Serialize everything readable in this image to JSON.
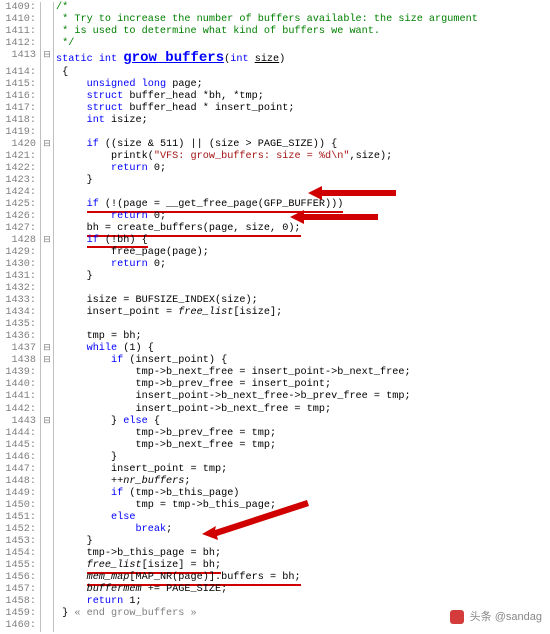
{
  "lines": [
    {
      "n": "1409:",
      "f": "",
      "html": "<span class='cmt'>/*</span>"
    },
    {
      "n": "1410:",
      "f": "",
      "html": "<span class='cmt'> * Try to increase the number of buffers available: the size argument</span>"
    },
    {
      "n": "1411:",
      "f": "",
      "html": "<span class='cmt'> * is used to determine what kind of buffers we want.</span>"
    },
    {
      "n": "1412:",
      "f": "",
      "html": "<span class='cmt'> */</span>"
    },
    {
      "n": "1413",
      "f": "⊟",
      "html": "<span class='kw'>static</span> <span class='kw'>int</span> <span class='fn und'>grow_buffers</span>(<span class='kw'>int</span> <span class='und'>size</span>)"
    },
    {
      "n": "1414:",
      "f": "",
      "html": " {"
    },
    {
      "n": "1415:",
      "f": "",
      "html": "     <span class='kw'>unsigned</span> <span class='kw'>long</span> page;"
    },
    {
      "n": "1416:",
      "f": "",
      "html": "     <span class='kw'>struct</span> buffer_head *bh, *tmp;"
    },
    {
      "n": "1417:",
      "f": "",
      "html": "     <span class='kw'>struct</span> buffer_head * insert_point;"
    },
    {
      "n": "1418:",
      "f": "",
      "html": "     <span class='kw'>int</span> isize;"
    },
    {
      "n": "1419:",
      "f": "",
      "html": ""
    },
    {
      "n": "1420",
      "f": "⊟",
      "html": "     <span class='kw'>if</span> ((size &amp; 511) || (size &gt; PAGE_SIZE)) {"
    },
    {
      "n": "1421:",
      "f": "",
      "html": "         printk(<span class='str'>\"VFS: grow_buffers: size = %d\\n\"</span>,size);"
    },
    {
      "n": "1422:",
      "f": "",
      "html": "         <span class='kw'>return</span> 0;"
    },
    {
      "n": "1423:",
      "f": "",
      "html": "     }"
    },
    {
      "n": "1424:",
      "f": "",
      "html": ""
    },
    {
      "n": "1425:",
      "f": "",
      "html": "     <span class='ul-red'><span class='kw'>if</span> (!(page = __get_free_page(GFP_BUFFER)))</span>"
    },
    {
      "n": "1426:",
      "f": "",
      "html": "         <span class='kw'>return</span> 0;"
    },
    {
      "n": "1427:",
      "f": "",
      "html": "     <span class='ul-red'>bh = create_buffers(page, size, 0);</span>"
    },
    {
      "n": "1428",
      "f": "⊟",
      "html": "     <span class='ul-red2'><span class='kw'>if</span> (!bh) {</span>"
    },
    {
      "n": "1429:",
      "f": "",
      "html": "         free_page(page);"
    },
    {
      "n": "1430:",
      "f": "",
      "html": "         <span class='kw'>return</span> 0;"
    },
    {
      "n": "1431:",
      "f": "",
      "html": "     }"
    },
    {
      "n": "1432:",
      "f": "",
      "html": ""
    },
    {
      "n": "1433:",
      "f": "",
      "html": "     isize = BUFSIZE_INDEX(size);"
    },
    {
      "n": "1434:",
      "f": "",
      "html": "     insert_point = <span style='font-style:italic'>free_list</span>[isize];"
    },
    {
      "n": "1435:",
      "f": "",
      "html": ""
    },
    {
      "n": "1436:",
      "f": "",
      "html": "     tmp = bh;"
    },
    {
      "n": "1437",
      "f": "⊟",
      "html": "     <span class='kw'>while</span> (1) {"
    },
    {
      "n": "1438",
      "f": "⊟",
      "html": "         <span class='kw'>if</span> (insert_point) {"
    },
    {
      "n": "1439:",
      "f": "",
      "html": "             tmp-&gt;b_next_free = insert_point-&gt;b_next_free;"
    },
    {
      "n": "1440:",
      "f": "",
      "html": "             tmp-&gt;b_prev_free = insert_point;"
    },
    {
      "n": "1441:",
      "f": "",
      "html": "             insert_point-&gt;b_next_free-&gt;b_prev_free = tmp;"
    },
    {
      "n": "1442:",
      "f": "",
      "html": "             insert_point-&gt;b_next_free = tmp;"
    },
    {
      "n": "1443",
      "f": "⊟",
      "html": "         } <span class='kw'>else</span> {"
    },
    {
      "n": "1444:",
      "f": "",
      "html": "             tmp-&gt;b_prev_free = tmp;"
    },
    {
      "n": "1445:",
      "f": "",
      "html": "             tmp-&gt;b_next_free = tmp;"
    },
    {
      "n": "1446:",
      "f": "",
      "html": "         }"
    },
    {
      "n": "1447:",
      "f": "",
      "html": "         insert_point = tmp;"
    },
    {
      "n": "1448:",
      "f": "",
      "html": "         ++<span style='font-style:italic'>nr_buffers</span>;"
    },
    {
      "n": "1449:",
      "f": "",
      "html": "         <span class='kw'>if</span> (tmp-&gt;b_this_page)"
    },
    {
      "n": "1450:",
      "f": "",
      "html": "             tmp = tmp-&gt;b_this_page;"
    },
    {
      "n": "1451:",
      "f": "",
      "html": "         <span class='kw'>else</span>"
    },
    {
      "n": "1452:",
      "f": "",
      "html": "             <span class='kw'>break</span>;"
    },
    {
      "n": "1453:",
      "f": "",
      "html": "     }"
    },
    {
      "n": "1454:",
      "f": "",
      "html": "     tmp-&gt;b_this_page = bh;"
    },
    {
      "n": "1455:",
      "f": "",
      "html": "     <span class='ul-red'><span style='font-style:italic'>free_list</span>[isize] = bh;</span>"
    },
    {
      "n": "1456:",
      "f": "",
      "html": "     <span class='ul-red'><span style='font-style:italic'>mem_map</span>[MAP_NR(page)].buffers = bh;</span>"
    },
    {
      "n": "1457:",
      "f": "",
      "html": "     <span style='font-style:italic'>buffermem</span> += PAGE_SIZE;"
    },
    {
      "n": "1458:",
      "f": "",
      "html": "     <span class='kw'>return</span> 1;"
    },
    {
      "n": "1459:",
      "f": "",
      "html": " } <span class='end'>« end grow_buffers »</span>"
    },
    {
      "n": "1460:",
      "f": "",
      "html": ""
    }
  ],
  "watermark": {
    "text": "头条",
    "handle": "@sandag"
  }
}
